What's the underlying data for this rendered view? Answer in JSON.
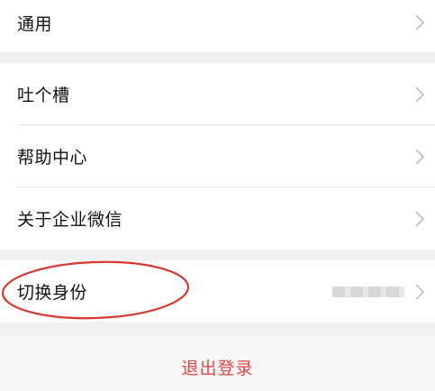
{
  "general": {
    "label": "通用"
  },
  "feedback_group": {
    "items": [
      {
        "label": "吐个槽"
      },
      {
        "label": "帮助中心"
      },
      {
        "label": "关于企业微信"
      }
    ]
  },
  "switch_identity": {
    "label": "切换身份"
  },
  "logout": {
    "label": "退出登录"
  },
  "colors": {
    "accent_red": "#e64340",
    "background": "#f0f0f0",
    "row_background": "#ffffff",
    "annotation_ellipse": "#d9362e"
  }
}
